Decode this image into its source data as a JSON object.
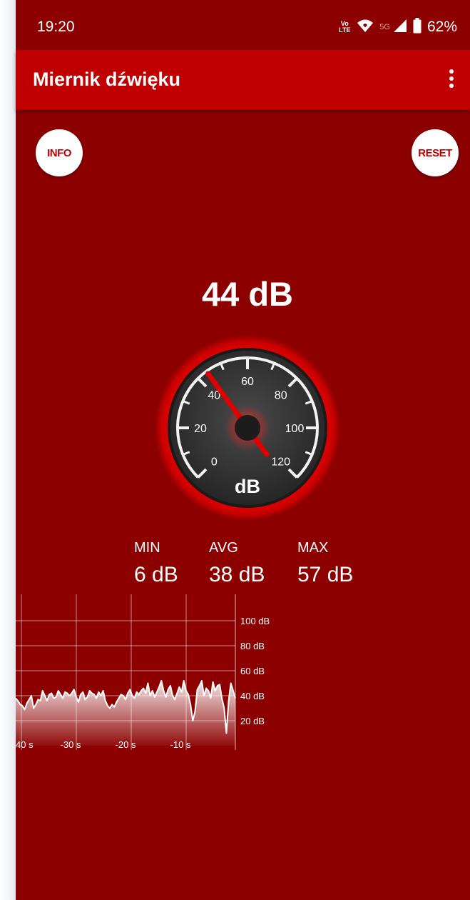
{
  "status_bar": {
    "time": "19:20",
    "volte_label": "Vo LTE",
    "network_label": "5G",
    "battery": "62%"
  },
  "app_bar": {
    "title": "Miernik dźwięku"
  },
  "buttons": {
    "info": "INFO",
    "reset": "RESET"
  },
  "meter": {
    "current_level": "44 dB",
    "unit": "dB",
    "needle_value": 44
  },
  "stats": {
    "min_label": "MIN",
    "avg_label": "AVG",
    "max_label": "MAX",
    "min_value": "6 dB",
    "avg_value": "38 dB",
    "max_value": "57 dB"
  },
  "colors": {
    "background": "#8c0000",
    "app_bar": "#c00000",
    "accent_red": "#e00000",
    "button_bg": "#ffffff"
  },
  "chart_data": {
    "type": "area",
    "x_ticks": [
      "40 s",
      "-30 s",
      "-20 s",
      "-10 s"
    ],
    "y_ticks": [
      "100 dB",
      "80 dB",
      "60 dB",
      "40 dB",
      "20 dB"
    ],
    "xlim": [
      -40,
      0
    ],
    "ylim": [
      0,
      110
    ],
    "grid": true,
    "values": [
      38,
      36,
      33,
      32,
      29,
      34,
      37,
      40,
      30,
      33,
      37,
      36,
      44,
      40,
      36,
      41,
      42,
      38,
      39,
      44,
      41,
      38,
      43,
      42,
      40,
      42,
      45,
      39,
      35,
      41,
      43,
      37,
      39,
      44,
      42,
      41,
      38,
      43,
      40,
      44,
      36,
      32,
      30,
      33,
      31,
      35,
      38,
      41,
      40,
      37,
      42,
      45,
      40,
      38,
      43,
      41,
      44,
      46,
      42,
      50,
      40,
      44,
      39,
      43,
      47,
      52,
      44,
      39,
      45,
      48,
      40,
      37,
      42,
      47,
      43,
      52,
      44,
      41,
      33,
      20,
      27,
      45,
      48,
      52,
      40,
      46,
      44,
      38,
      51,
      44,
      48,
      49,
      38,
      30,
      10,
      36,
      50,
      44,
      38
    ]
  }
}
